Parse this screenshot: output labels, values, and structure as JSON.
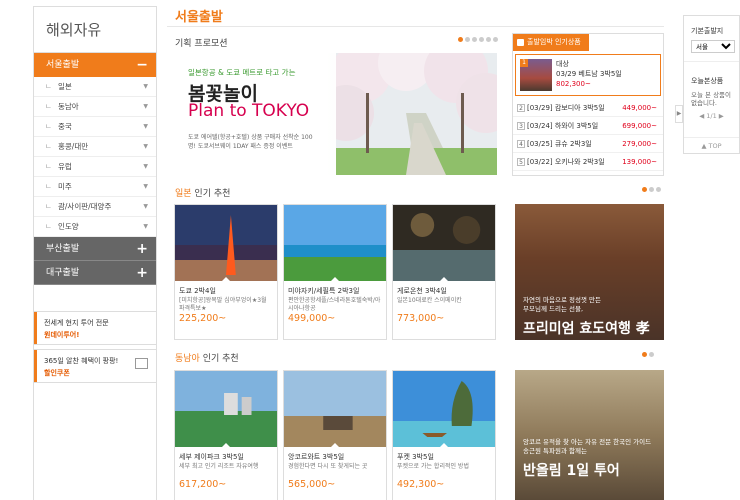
{
  "sidebar": {
    "title": "해외자유",
    "categories": [
      {
        "label": "서울출발",
        "toggle": "−"
      },
      {
        "label": "부산출발",
        "toggle": "+"
      },
      {
        "label": "대구출발",
        "toggle": "+"
      }
    ],
    "sub_items": [
      "일본",
      "동남아",
      "중국",
      "홍콩/대만",
      "유럽",
      "미주",
      "괌/사이판/대양주",
      "인도양"
    ],
    "sub_mark": "ㄴ",
    "sub_arrow": "▼",
    "box1": {
      "line": "전세계 현지 투어 전문",
      "highlight": "원데이투어!"
    },
    "box2": {
      "line": "365일 알찬 혜택이 팡팡!",
      "highlight": "할인쿠폰"
    }
  },
  "main": {
    "title": "서울출발",
    "plan_title": "기획 프로모션",
    "banner": {
      "line1": "일본항공 & 도쿄 메트로 타고 가는",
      "line2": "봄꽃놀이",
      "line3": "Plan to TOKYO",
      "line4": "도쿄 에어텔(항공+호텔) 상품 구매자 선착순 100명! 도쿄서브웨이 1DAY 패스 증정 이벤트"
    },
    "rank": {
      "title": "출발임박 인기상품",
      "top": {
        "num": "1",
        "line1": "대상",
        "line2": "03/29 베트남  3박5일",
        "price": "802,300~"
      },
      "rows": [
        {
          "num": "2",
          "text": "[03/29] 캄보디아  3박5일",
          "price": "449,000~"
        },
        {
          "num": "3",
          "text": "[03/24] 하와이  3박5일",
          "price": "699,000~"
        },
        {
          "num": "4",
          "text": "[03/25] 큐슈  2박3일",
          "price": "279,000~"
        },
        {
          "num": "5",
          "text": "[03/22] 오키나와  2박3일",
          "price": "139,000~"
        }
      ]
    },
    "japan_section": {
      "hl": "일본",
      "rest": " 인기 추천"
    },
    "japan_cards": [
      {
        "title": "도쿄 2박4일",
        "desc": "[미치항공]왕복말 심야부엉이★3월 파격특보★",
        "price": "225,200~"
      },
      {
        "title": "미야자키/세필특 2박3일",
        "desc": "편안한공항세플/스네라톤호텔숙박/아시아나항공",
        "price": "499,000~"
      },
      {
        "title": "게로온천 3박4일",
        "desc": "일본10대료칸 스이메이칸",
        "price": "773,000~"
      }
    ],
    "japan_promo": {
      "line1": "자연의 마음으로 정성껏 만든",
      "line2": "부모님께 드리는 선물,",
      "title": "프리미엄 효도여행 孝"
    },
    "sea_section": {
      "hl": "동남아",
      "rest": " 인기 추천"
    },
    "sea_cards": [
      {
        "title": "세부 제이파크 3박5일",
        "desc": "세부 최고 인기 리조트 자유여행",
        "price": "617,200~"
      },
      {
        "title": "앙코르와트 3박5일",
        "desc": "경험한다면 다시 또 찾게되는 곳",
        "price": "565,000~"
      },
      {
        "title": "푸켓 3박5일",
        "desc": "푸켓으로 가는 합리적인 방법",
        "price": "492,300~"
      }
    ],
    "sea_promo": {
      "line1": "앙코르 유적을 찾 아는 자유 전문 한국인 가이드",
      "line2": "송근원 특파원과 함께는",
      "title": "반올림 1일 투어"
    }
  },
  "right_panel": {
    "label1": "기본출발지",
    "select_value": "서울",
    "label2": "오늘본상품",
    "empty": "오늘 본 상품이 없습니다.",
    "pager": "1/1",
    "top": "▲ TOP"
  },
  "colors": {
    "accent": "#f07c1b",
    "price": "#e0001b"
  }
}
